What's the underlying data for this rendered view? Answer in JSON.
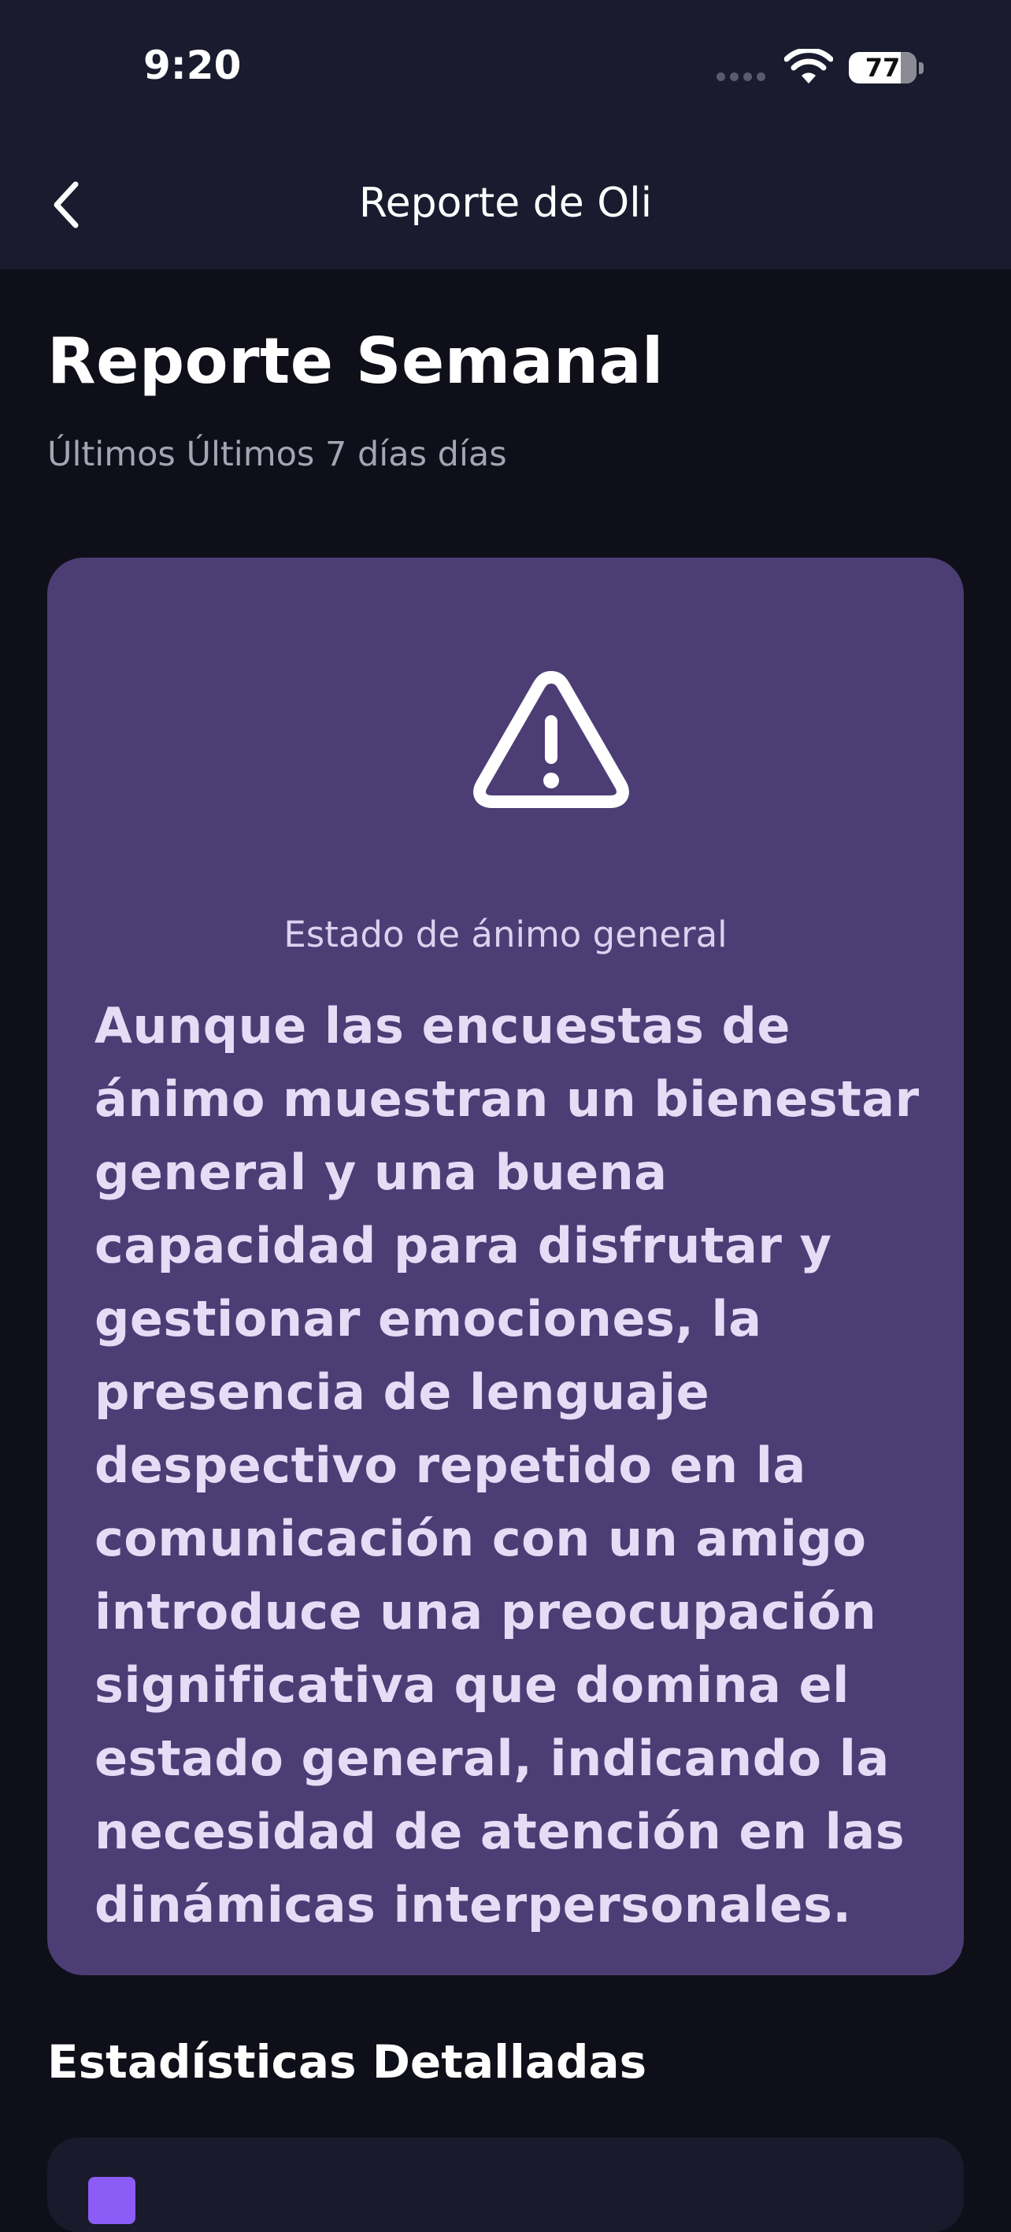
{
  "status_bar": {
    "time": "9:20",
    "battery": "77"
  },
  "nav": {
    "title": "Reporte de Oli",
    "back_icon": "chevron-left-icon"
  },
  "page": {
    "title": "Reporte Semanal",
    "subtitle": "Últimos Últimos 7 días días"
  },
  "mood_card": {
    "icon": "warning-triangle-icon",
    "label": "Estado de ánimo general",
    "text": "Aunque las encuestas de ánimo muestran un bienestar general y una buena capacidad para disfrutar y gestionar emociones, la presencia de lenguaje despectivo repetido en la comunicación con un amigo introduce una preocupación significativa que domina el estado general, indicando la necesidad de atención en las dinámicas interpersonales.",
    "background_color": "#4d3d75"
  },
  "stats": {
    "section_title": "Estadísticas Detalladas",
    "accent_color": "#8b5cf6"
  }
}
